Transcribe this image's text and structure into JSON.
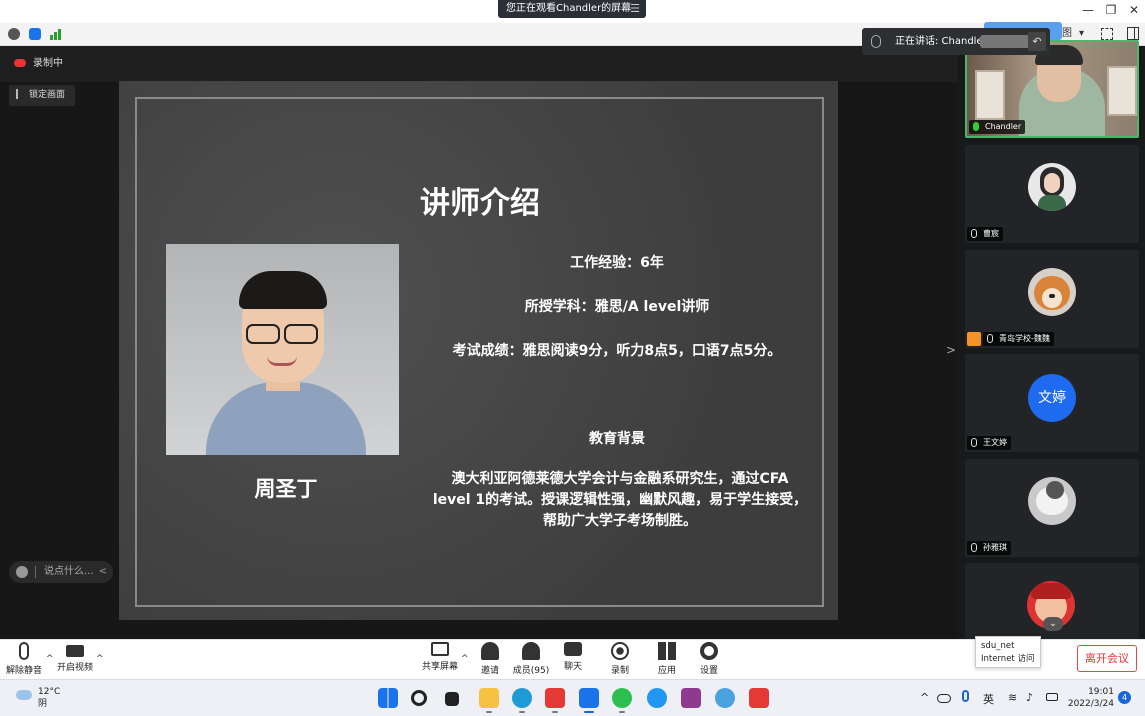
{
  "window": {
    "share_banner": "您正在观看Chandler的屏幕",
    "controls": {
      "minimize": "—",
      "restore": "❐",
      "close": "✕"
    },
    "layout_label": "图",
    "layout_caret": "▾"
  },
  "speaking": {
    "label": "正在讲话: Chandler;",
    "undo": "↶"
  },
  "recording": {
    "label": "录制中"
  },
  "lock_view": {
    "label": "锁定画面"
  },
  "chat": {
    "placeholder": "说点什么...",
    "collapse": "<"
  },
  "slide": {
    "title": "讲师介绍",
    "teacher_name": "周圣丁",
    "experience": "工作经验：6年",
    "subjects": "所授学科：雅思/A level讲师",
    "scores": "考试成绩：雅思阅读9分，听力8点5，口语7点5分。",
    "edu_heading": "教育背景",
    "edu_lines": [
      "澳大利亚阿德莱德大学会计与金融系研究生，通过CFA",
      "level 1的考试。授课逻辑性强，幽默风趣，易于学生接受，",
      "帮助广大学子考场制胜。"
    ]
  },
  "panel_arrow": ">",
  "participants": [
    {
      "name": "Chandler",
      "speaking": true
    },
    {
      "name": "曹宸"
    },
    {
      "name": "青岛学校-魏魏"
    },
    {
      "name": "王文婷",
      "avatar_text": "文婷",
      "avatar_color": "#1f6bf0"
    },
    {
      "name": "孙雅琪"
    }
  ],
  "gallery_more": "⌄",
  "meeting_toolbar": {
    "unmute": "解除静音",
    "start_video": "开启视频",
    "share_screen": "共享屏幕",
    "invite": "邀请",
    "members": "成员(95)",
    "chat": "聊天",
    "record": "录制",
    "apps": "应用",
    "settings": "设置",
    "leave": "离开会议",
    "caret": "^"
  },
  "network_tip": {
    "line1": "sdu_net",
    "line2": "Internet 访问"
  },
  "taskbar": {
    "temperature": "12°C",
    "weather": "阴",
    "ime": "英",
    "time": "19:01",
    "date": "2022/3/24",
    "notifications": "4",
    "tray_up": "^"
  },
  "colors": {
    "accent_green": "#4ab86a",
    "leave_red": "#e33333",
    "win_blue": "#1a66d6"
  }
}
